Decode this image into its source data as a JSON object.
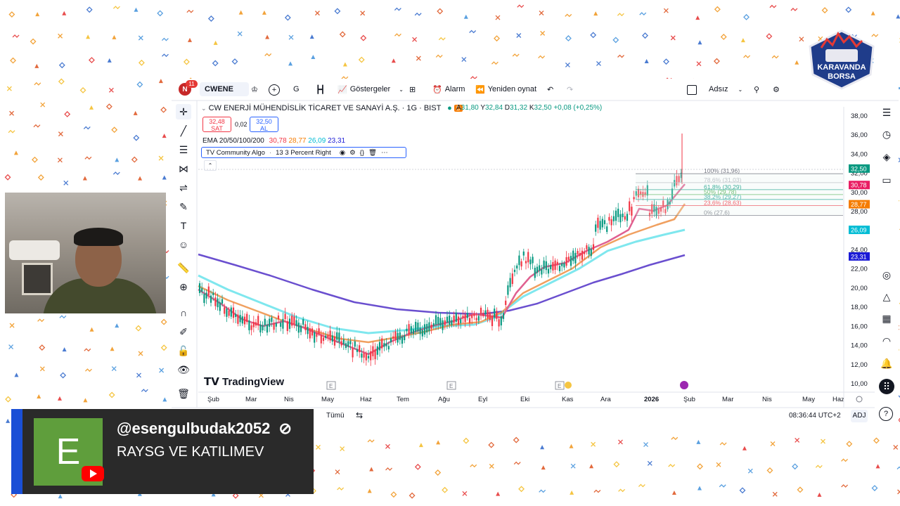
{
  "toolbar": {
    "notifications": "11",
    "avatar_letter": "N",
    "symbol": "CWENE",
    "interval": "G",
    "indicators": "Göstergeler",
    "alarm": "Alarm",
    "replay": "Yeniden oynat",
    "layout_name": "Adsız"
  },
  "header": {
    "title": "CW ENERJİ MÜHENDİSLİK TİCARET VE SANAYİ A.Ş. · 1G · BIST",
    "open": "31,80",
    "high": "32,84",
    "low": "31,32",
    "close": "32,50",
    "change": "+0,08 (+0,25%)",
    "sell_price": "32,48",
    "sell_label": "SAT",
    "spread": "0,02",
    "buy_price": "32,50",
    "buy_label": "AL"
  },
  "indicators": {
    "ema_label": "EMA 20/50/100/200",
    "ema_values": [
      "30,78",
      "28,77",
      "26,09",
      "23,31"
    ],
    "algo_name": "TV Community Algo",
    "algo_params": "13 3 Percent Right"
  },
  "fib_levels": [
    {
      "label": "100% (31,96)",
      "value": 31.96,
      "color": "#787b86"
    },
    {
      "label": "78,6% (31,03)",
      "value": 31.03,
      "color": "#b2b5be"
    },
    {
      "label": "61,8% (30,29)",
      "value": 30.29,
      "color": "#089981"
    },
    {
      "label": "50% (29,78)",
      "value": 29.78,
      "color": "#4caf50"
    },
    {
      "label": "38,2% (29,27)",
      "value": 29.27,
      "color": "#26a69a"
    },
    {
      "label": "23,6% (28,63)",
      "value": 28.63,
      "color": "#f23645"
    },
    {
      "label": "0% (27,6)",
      "value": 27.6,
      "color": "#787b86"
    }
  ],
  "price_axis": [
    "38,00",
    "36,00",
    "34,00",
    "32,00",
    "30,00",
    "28,00",
    "24,00",
    "22,00",
    "20,00",
    "18,00",
    "16,00",
    "14,00",
    "12,00",
    "10,00"
  ],
  "price_badges": [
    {
      "label": "32,50",
      "value": 32.5,
      "color": "#089981"
    },
    {
      "label": "30,78",
      "value": 30.78,
      "color": "#e91e63"
    },
    {
      "label": "28,77",
      "value": 28.77,
      "color": "#f57c00"
    },
    {
      "label": "26,09",
      "value": 26.09,
      "color": "#00bcd4"
    },
    {
      "label": "23,31",
      "value": 23.31,
      "color": "#1a1ad6"
    }
  ],
  "time_axis": [
    "Şub",
    "Mar",
    "Nis",
    "May",
    "Haz",
    "Tem",
    "Ağu",
    "Eyl",
    "Eki",
    "Kas",
    "Ara",
    "2026",
    "Şub",
    "Mar",
    "Nis",
    "May",
    "Haz"
  ],
  "watermark": "TradingView",
  "bottom": {
    "range_all": "Tümü",
    "clock": "08:36:44 UTC+2",
    "adj": "ADJ"
  },
  "colors": {
    "up": "#089981",
    "down": "#f23645",
    "ema20": "#e06090",
    "ema50": "#f0a060",
    "ema100": "#7fe7ee",
    "ema200": "#6a4fcf"
  },
  "channel": {
    "avatar_letter": "E",
    "handle": "@esengulbudak2052",
    "subtitle": "RAYSG VE KATILIMEV"
  },
  "logo": {
    "line1": "KARAVANDA",
    "line2": "BORSA"
  }
}
